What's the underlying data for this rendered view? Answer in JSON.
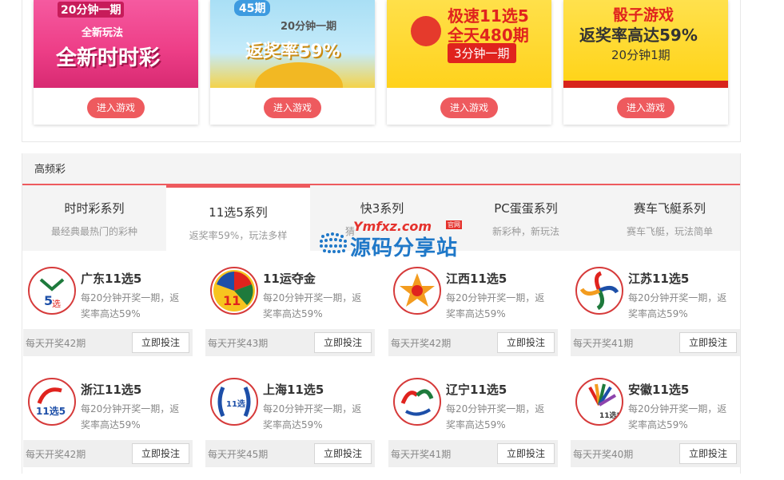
{
  "promos": [
    {
      "line1": "20分钟一期",
      "line2": "全新玩法",
      "line3": "全新时时彩",
      "btn": "进入游戏"
    },
    {
      "line1": "45期",
      "line2": "20分钟一期",
      "line3": "返奖率59%",
      "btn": "进入游戏"
    },
    {
      "line1": "极速11选5",
      "line2": "全天480期",
      "line3": "3分钟一期",
      "btn": "进入游戏"
    },
    {
      "line1": "骰子游戏",
      "line2": "返奖率高达59%",
      "line3": "20分钟1期",
      "btn": "进入游戏"
    }
  ],
  "section_title": "高频彩",
  "tabs": [
    {
      "title": "时时彩系列",
      "sub": "最经典最热门的彩种"
    },
    {
      "title": "11选5系列",
      "sub": "返奖率59%，玩法多样"
    },
    {
      "title": "快3系列",
      "sub": "猜"
    },
    {
      "title": "PC蛋蛋系列",
      "sub": "新彩种，新玩法"
    },
    {
      "title": "赛车飞艇系列",
      "sub": "赛车飞艇，玩法简单"
    }
  ],
  "games": [
    {
      "name": "广东11选5",
      "desc": "每20分钟开奖一期，返奖率高达59%",
      "draws": "每天开奖42期",
      "btn": "立即投注"
    },
    {
      "name": "11运夺金",
      "desc": "每20分钟开奖一期，返奖率高达59%",
      "draws": "每天开奖43期",
      "btn": "立即投注"
    },
    {
      "name": "江西11选5",
      "desc": "每20分钟开奖一期，返奖率高达59%",
      "draws": "每天开奖42期",
      "btn": "立即投注"
    },
    {
      "name": "江苏11选5",
      "desc": "每20分钟开奖一期，返奖率高达59%",
      "draws": "每天开奖41期",
      "btn": "立即投注"
    },
    {
      "name": "浙江11选5",
      "desc": "每20分钟开奖一期，返奖率高达59%",
      "draws": "每天开奖42期",
      "btn": "立即投注"
    },
    {
      "name": "上海11选5",
      "desc": "每20分钟开奖一期，返奖率高达59%",
      "draws": "每天开奖45期",
      "btn": "立即投注"
    },
    {
      "name": "辽宁11选5",
      "desc": "每20分钟开奖一期，返奖率高达59%",
      "draws": "每天开奖41期",
      "btn": "立即投注"
    },
    {
      "name": "安徽11选5",
      "desc": "每20分钟开奖一期，返奖率高达59%",
      "draws": "每天开奖40期",
      "btn": "立即投注"
    }
  ],
  "watermark": {
    "top": "Ymfxz.com",
    "tag": "官网",
    "main": "源码分享站"
  }
}
